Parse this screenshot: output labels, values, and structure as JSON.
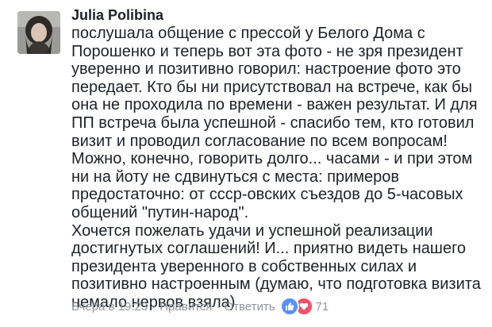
{
  "comment": {
    "author": "Julia Polibina",
    "lines": [
      "послушала общение с прессой у Белого Дома с",
      "Порошенко и теперь вот эта фото - не зря президент",
      "уверенно и позитивно говорил: настроение фото это",
      "передает. Кто бы ни присутствовал на встрече, как бы",
      "она не проходила по времени - важен результат. И для",
      "ПП встреча была успешной - спасибо тем, кто готовил",
      "визит и проводил согласование по всем вопросам!",
      "Можно, конечно, говорить долго... часами - и при этом",
      "ни на йоту не сдвинуться с места: примеров",
      "предостаточно: от ссср-овских съездов до 5-часовых",
      "общений \"путин-народ\".",
      "Хочется пожелать удачи и успешной реализации",
      "достигнутых соглашений! И... приятно видеть нашего",
      "президента уверенного в собственных силах и",
      "позитивно настроенным (думаю, что подготовка визита",
      "немало нервов взяла)"
    ]
  },
  "meta": {
    "timestamp": "Вчера в 19:23",
    "separator": "·",
    "like_label": "Нравится",
    "reply_label": "Ответить",
    "reaction_count": "71"
  },
  "colors": {
    "text": "#1d2129",
    "meta": "#90949c",
    "like_reaction": "#5890ff",
    "love_reaction": "#f25268"
  },
  "icons": {
    "avatar": "profile-photo",
    "like": "thumbs-up-icon",
    "love": "heart-icon"
  }
}
